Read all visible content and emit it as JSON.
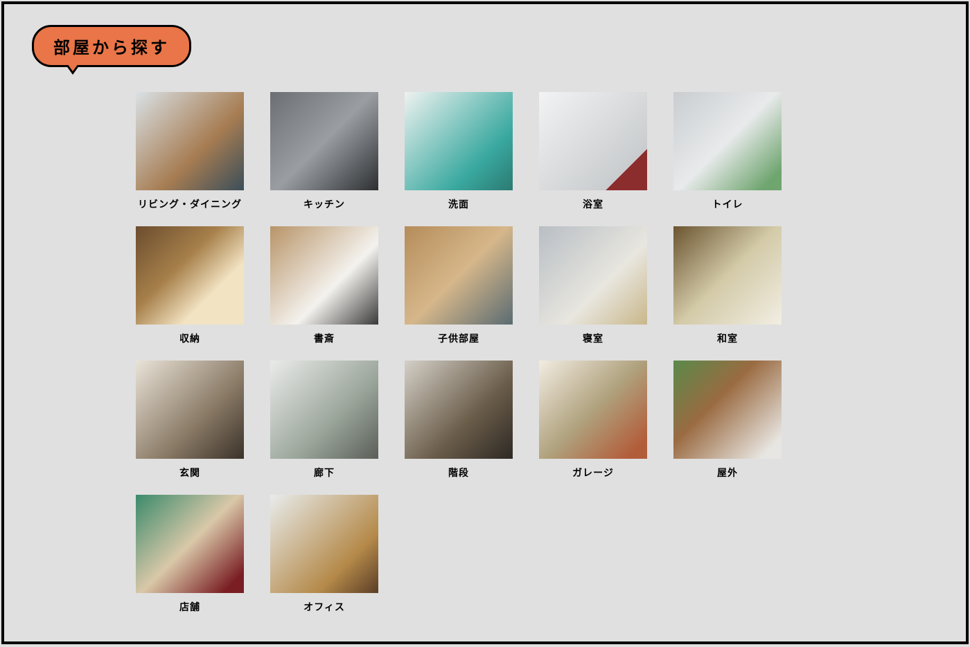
{
  "section_title": "部屋から探す",
  "categories": [
    {
      "name": "living-dining",
      "label": "リビング・ダイニング",
      "thumb": "t1"
    },
    {
      "name": "kitchen",
      "label": "キッチン",
      "thumb": "t2"
    },
    {
      "name": "washroom",
      "label": "洗面",
      "thumb": "t3"
    },
    {
      "name": "bathroom",
      "label": "浴室",
      "thumb": "t4"
    },
    {
      "name": "toilet",
      "label": "トイレ",
      "thumb": "t5"
    },
    {
      "name": "storage",
      "label": "収納",
      "thumb": "t6"
    },
    {
      "name": "study",
      "label": "書斎",
      "thumb": "t7"
    },
    {
      "name": "kids-room",
      "label": "子供部屋",
      "thumb": "t8"
    },
    {
      "name": "bedroom",
      "label": "寝室",
      "thumb": "t9"
    },
    {
      "name": "japanese-room",
      "label": "和室",
      "thumb": "t10"
    },
    {
      "name": "entrance",
      "label": "玄関",
      "thumb": "t11"
    },
    {
      "name": "corridor",
      "label": "廊下",
      "thumb": "t12"
    },
    {
      "name": "stairs",
      "label": "階段",
      "thumb": "t13"
    },
    {
      "name": "garage",
      "label": "ガレージ",
      "thumb": "t14"
    },
    {
      "name": "outdoor",
      "label": "屋外",
      "thumb": "t15"
    },
    {
      "name": "shop",
      "label": "店舗",
      "thumb": "t16"
    },
    {
      "name": "office",
      "label": "オフィス",
      "thumb": "t17"
    }
  ]
}
